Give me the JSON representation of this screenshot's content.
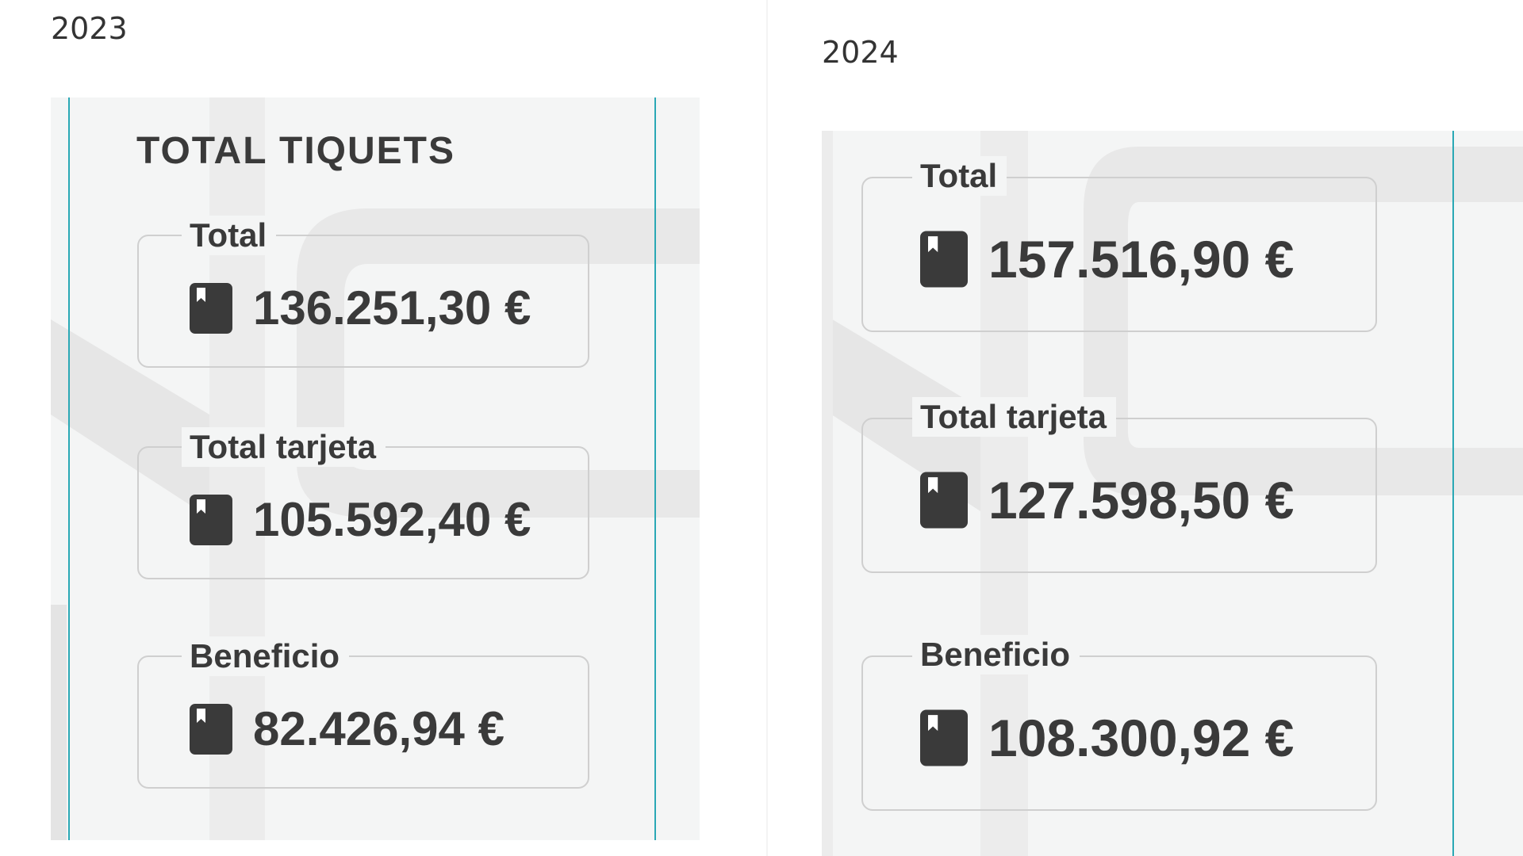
{
  "panels": [
    {
      "year": "2023",
      "heading": "TOTAL TIQUETS",
      "stats": [
        {
          "label": "Total",
          "value": "136.251,30 €",
          "icon": "book-icon"
        },
        {
          "label": "Total tarjeta",
          "value": "105.592,40 €",
          "icon": "book-icon"
        },
        {
          "label": "Beneficio",
          "value": "82.426,94 €",
          "icon": "book-icon"
        }
      ]
    },
    {
      "year": "2024",
      "heading": "",
      "stats": [
        {
          "label": "Total",
          "value": "157.516,90 €",
          "icon": "book-icon"
        },
        {
          "label": "Total tarjeta",
          "value": "127.598,50 €",
          "icon": "book-icon"
        },
        {
          "label": "Beneficio",
          "value": "108.300,92 €",
          "icon": "book-icon"
        }
      ]
    }
  ],
  "colors": {
    "accent": "#2aa8b5",
    "panel_bg": "#f4f5f5",
    "text": "#3a3a3a",
    "border": "#cfcfcf"
  }
}
